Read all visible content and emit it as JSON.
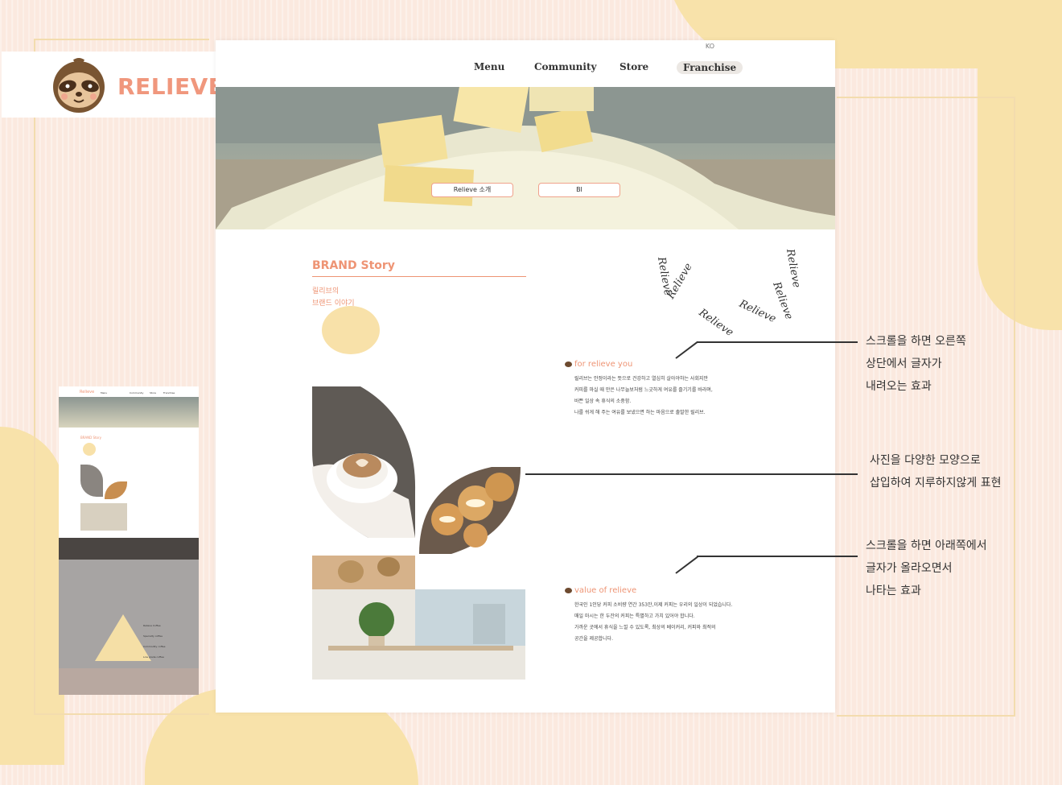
{
  "banner": {
    "title": "RELIEVE 소개 PAGE"
  },
  "page": {
    "lang": "KO",
    "nav": [
      "Menu",
      "Community",
      "Store",
      "Franchise"
    ],
    "hero_buttons": [
      "Relieve 소개",
      "BI"
    ],
    "brand": {
      "title": "BRAND Story",
      "sub1": "릴리브의",
      "sub2": "브랜드 이야기"
    },
    "circular_text": "Relieve",
    "section1": {
      "title": "for relieve you",
      "lines": [
        "릴리브는 안정이라는 뜻으로 건강하고 열심히 살아야하는 사회지만",
        "커피를 마실 때 만은 나무늘보처럼 느긋하게 여유를 즐기기를 바라며,",
        "바쁜 일상 속 휴식의 소중함.",
        "나를 쉬게 해 주는 여유를 보냈으면 하는 마음으로 출발한 릴리브."
      ]
    },
    "section2": {
      "title": "value of relieve",
      "lines": [
        "한국인 1인당 커피 소비량 연간 353잔,이제 커피는 우리의 일상이 되었습니다.",
        "매일 마시는 한 두잔의 커피는 특별하고 가치 있어야 합니다.",
        "가까운 곳에서 휴식을 느낄 수 있도록, 최상의 베이커리, 커피와 최적의",
        "공간을 제공합니다."
      ]
    }
  },
  "annotations": [
    {
      "lines": [
        "스크롤을 하면 오른쪽",
        "상단에서 글자가",
        "내려오는 효과"
      ]
    },
    {
      "lines": [
        "사진을 다양한 모양으로",
        "삽입하여 지루하지않게 표현"
      ]
    },
    {
      "lines": [
        "스크롤을 하면 아래쪽에서",
        "글자가 올라오면서",
        "나타는 효과"
      ]
    }
  ],
  "thumbnail": {
    "nav": [
      "Relieve",
      "Menu",
      "Community",
      "Store",
      "Franchise"
    ],
    "brand_title": "BRAND Story",
    "pyramid": [
      "Relieve Coffee",
      "Specialty coffee",
      "Commodity coffee",
      "Low grade coffee"
    ]
  },
  "colors": {
    "accent": "#ee9474",
    "blob": "#f8e2aa",
    "bg": "#fbe9df",
    "brown": "#6d4a2f"
  }
}
